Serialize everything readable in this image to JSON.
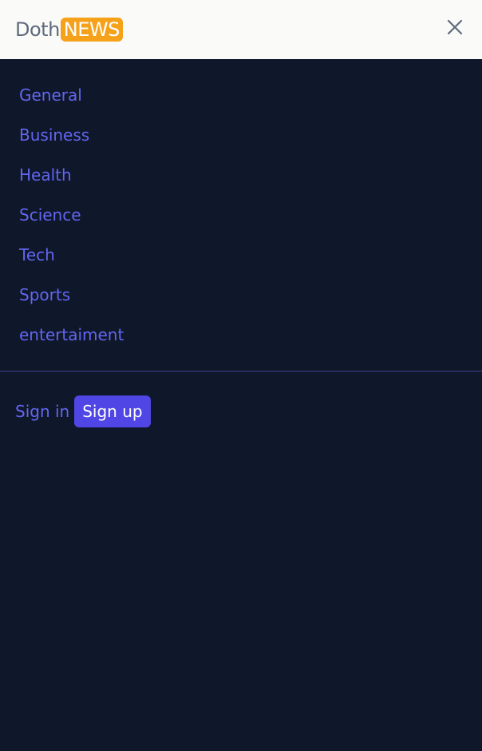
{
  "header": {
    "logo_text": "Doth",
    "logo_badge": "NEWS",
    "close_icon": "close-icon"
  },
  "nav": {
    "items": [
      {
        "label": "General"
      },
      {
        "label": "Business"
      },
      {
        "label": "Health"
      },
      {
        "label": "Science"
      },
      {
        "label": "Tech"
      },
      {
        "label": "Sports"
      },
      {
        "label": "entertaiment"
      }
    ]
  },
  "auth": {
    "signin_label": "Sign in",
    "signup_label": "Sign up"
  },
  "colors": {
    "background": "#0f172a",
    "header_bg": "#fafaf8",
    "accent_orange": "#f5a11a",
    "link_indigo": "#6366f1",
    "button_indigo": "#4f46e5"
  }
}
